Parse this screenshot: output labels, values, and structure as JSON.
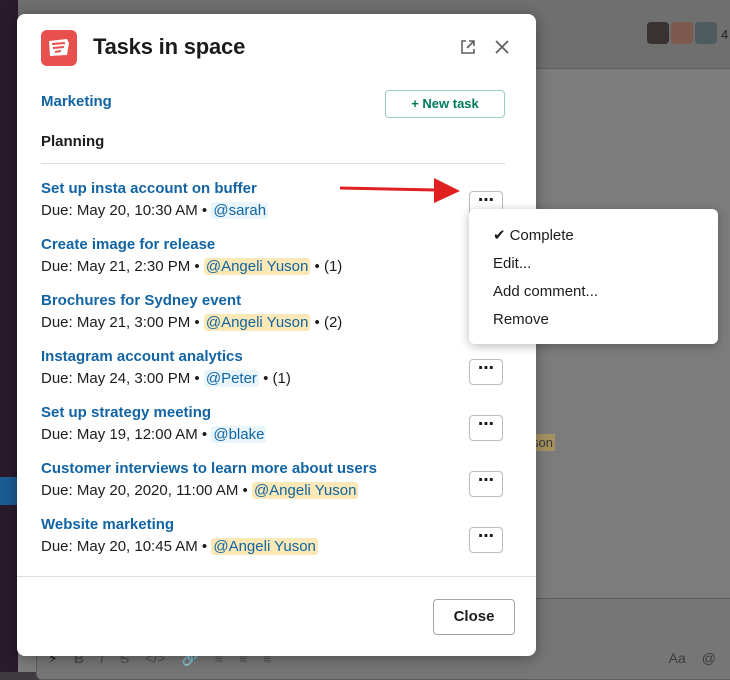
{
  "background": {
    "member_count": "4",
    "mention_fragment": "son",
    "toolbar_icons": [
      "⚡",
      "B",
      "I",
      "S",
      "</>",
      "🔗",
      "≡",
      "≡",
      "≡",
      "⋯"
    ],
    "toolbar_right": [
      "Aa",
      "@"
    ]
  },
  "modal": {
    "title": "Tasks in space",
    "open_icon": "open-in-new-window-icon",
    "close_icon": "close-icon",
    "project_link": "Marketing",
    "new_task_label": "+ New task",
    "section_title": "Planning",
    "tasks": [
      {
        "title": "Set up insta account on buffer",
        "due": "Due: May 20, 10:30 AM",
        "assignee": "@sarah",
        "comments": ""
      },
      {
        "title": "Create image for release",
        "due": "Due: May 21, 2:30 PM",
        "assignee": "@Angeli Yuson",
        "comments": "(1)"
      },
      {
        "title": "Brochures for Sydney event",
        "due": "Due: May 21, 3:00 PM",
        "assignee": "@Angeli Yuson",
        "comments": "(2)"
      },
      {
        "title": "Instagram account analytics",
        "due": "Due: May 24, 3:00 PM",
        "assignee": "@Peter",
        "comments": "(1)"
      },
      {
        "title": "Set up strategy meeting",
        "due": "Due: May 19, 12:00 AM",
        "assignee": "@blake",
        "comments": ""
      },
      {
        "title": "Customer interviews to learn more about users",
        "due": "Due: May 20, 2020, 11:00 AM",
        "assignee": "@Angeli Yuson",
        "comments": ""
      },
      {
        "title": "Website marketing",
        "due": "Due: May 20, 10:45 AM",
        "assignee": "@Angeli Yuson",
        "comments": ""
      }
    ],
    "more_label": "⋯",
    "close_label": "Close"
  },
  "context_menu": {
    "items": [
      {
        "label": "Complete",
        "icon": "checkmark-icon",
        "check": "✔"
      },
      {
        "label": "Edit..."
      },
      {
        "label": "Add comment..."
      },
      {
        "label": "Remove"
      }
    ]
  },
  "colors": {
    "link": "#1264a3",
    "accent_green": "#007a5a",
    "app_icon": "#e8504d",
    "mention_bg": "#fbe8b7",
    "arrow": "#e02020"
  }
}
